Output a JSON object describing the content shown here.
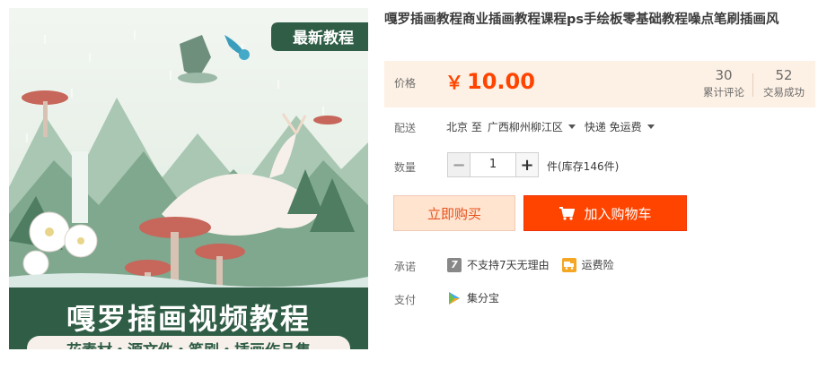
{
  "product": {
    "title": "嘎罗插画教程商业插画教程课程ps手绘板零基础教程噪点笔刷插画风",
    "image": {
      "badge": "最新教程",
      "banner_title": "嘎罗插画视频教程",
      "banner_subtitle": "花素材・源文件・笔刷・插画作品集"
    }
  },
  "price": {
    "label": "价格",
    "currency": "￥",
    "value": "10.00",
    "reviews_count": "30",
    "reviews_label": "累计评论",
    "sales_count": "52",
    "sales_label": "交易成功"
  },
  "shipping": {
    "label": "配送",
    "from": "北京 至",
    "to": "广西柳州柳江区",
    "method": "快递 免运费"
  },
  "quantity": {
    "label": "数量",
    "value": "1",
    "minus": "−",
    "plus": "+",
    "stock": "件(库存146件)"
  },
  "actions": {
    "buy_now": "立即购买",
    "add_to_cart": "加入购物车"
  },
  "promise": {
    "label": "承诺",
    "no_return_icon": "7",
    "no_return_text": "不支持7天无理由",
    "shipping_insurance": "运费险"
  },
  "payment": {
    "label": "支付",
    "method": "集分宝"
  },
  "colors": {
    "accent": "#ff4400",
    "price_bg": "#fdf0e4",
    "buy_bg": "#ffe4d0",
    "banner_green": "#2f5d45"
  },
  "icons": [
    "cart-icon",
    "dropdown-arrow-icon",
    "seven-day-icon",
    "shipping-insurance-icon",
    "jifenbao-icon"
  ]
}
